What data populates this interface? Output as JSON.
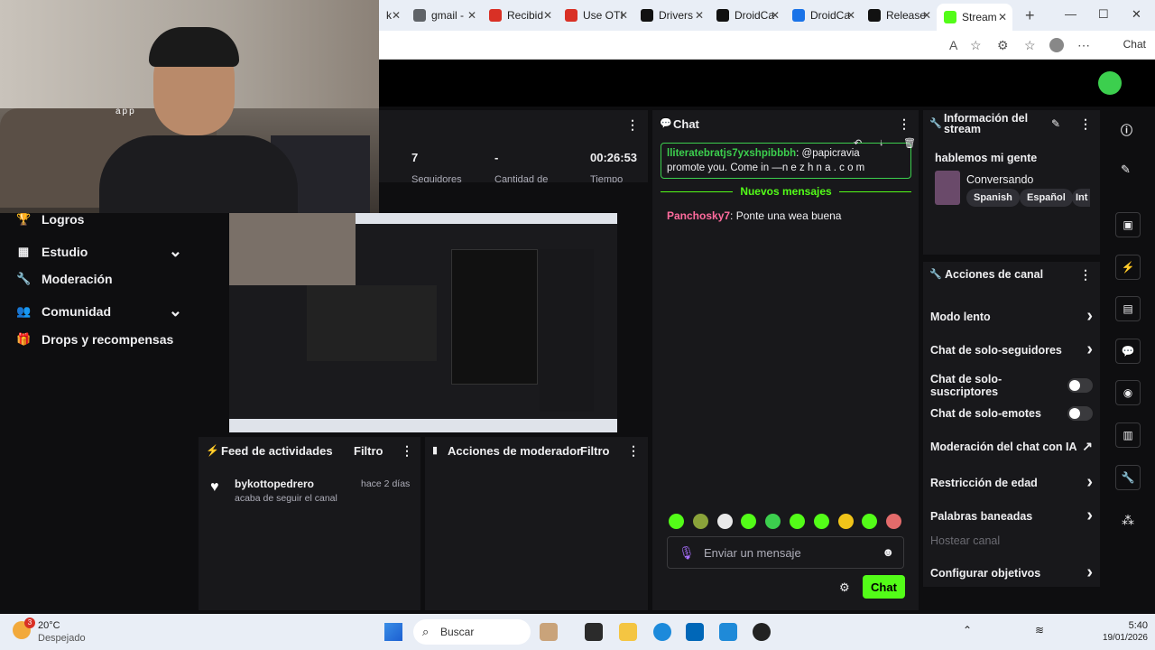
{
  "browser": {
    "tabs": [
      {
        "label": "k",
        "icon": "generic-tab-icon",
        "color": "#999999"
      },
      {
        "label": "gmail -",
        "icon": "search-icon",
        "color": "#5f6368"
      },
      {
        "label": "Recibid",
        "icon": "gmail-icon",
        "color": "#d93025"
      },
      {
        "label": "Use OTI",
        "icon": "gmail-icon",
        "color": "#d93025"
      },
      {
        "label": "Drivers",
        "icon": "app-icon",
        "color": "#111111"
      },
      {
        "label": "DroidCa",
        "icon": "github-icon",
        "color": "#111111"
      },
      {
        "label": "DroidCa",
        "icon": "app-store-icon",
        "color": "#1a73e8"
      },
      {
        "label": "Release",
        "icon": "github-icon",
        "color": "#111111"
      },
      {
        "label": "Stream",
        "icon": "kick-icon",
        "color": "#53fc18",
        "active": true
      }
    ],
    "chat_label": "Chat"
  },
  "webcam_overlay_text": "app",
  "left_menu": {
    "items": [
      {
        "label": "Logros",
        "icon": "trophy-icon",
        "expandable": false
      },
      {
        "label": "Estudio",
        "icon": "studio-icon",
        "expandable": true
      },
      {
        "label": "Moderación",
        "icon": "wrench-icon",
        "expandable": false
      },
      {
        "label": "Comunidad",
        "icon": "community-icon",
        "expandable": true
      },
      {
        "label": "Drops y recompensas",
        "icon": "gift-icon",
        "expandable": false
      }
    ]
  },
  "stats": {
    "followers": "7",
    "followers_label": "Seguidores",
    "quantity": "-",
    "quantity_label": "Cantidad de",
    "time": "00:26:53",
    "time_label": "Tiempo"
  },
  "activity_feed": {
    "title": "Feed de actividades",
    "filter": "Filtro",
    "items": [
      {
        "user": "bykottopedrero",
        "action": "acaba de seguir el canal",
        "time": "hace 2 días"
      }
    ]
  },
  "mod_actions": {
    "title": "Acciones de moderador",
    "filter": "Filtro"
  },
  "chat": {
    "title": "Chat",
    "pinned": {
      "user": "lliteratebratjs7yxshpibbbh",
      "text": ": @papicravia",
      "text_cont": "promote you. Come  in —n e z h n a . c o m"
    },
    "new_messages": "Nuevos mensajes",
    "messages": [
      {
        "user": "Panchosky7",
        "text": ": Ponte una wea buena"
      }
    ],
    "input_placeholder": "Enviar un mensaje",
    "send_label": "Chat"
  },
  "stream_info": {
    "title": "Información del stream",
    "stream_title": "hablemos mi gente",
    "category": "Conversando",
    "tags": [
      "Spanish",
      "Español",
      "Int"
    ]
  },
  "channel_actions": {
    "title": "Acciones de canal",
    "items": [
      {
        "label": "Modo lento",
        "control": "chevron"
      },
      {
        "label": "Chat de solo-seguidores",
        "control": "chevron"
      },
      {
        "label": "Chat de solo-suscriptores",
        "control": "toggle"
      },
      {
        "label": "Chat de solo-emotes",
        "control": "toggle"
      },
      {
        "label": "Moderación del chat con IA",
        "control": "external"
      },
      {
        "label": "Restricción de edad",
        "control": "chevron"
      },
      {
        "label": "Palabras baneadas",
        "control": "chevron"
      },
      {
        "label": "Hostear canal",
        "control": "none",
        "disabled": true
      },
      {
        "label": "Configurar objetivos",
        "control": "chevron"
      }
    ]
  },
  "taskbar": {
    "temperature": "20°C",
    "weather": "Despejado",
    "weather_badge": "3",
    "search": "Buscar",
    "time": "5:40",
    "date": "19/01/2026"
  },
  "colors": {
    "accent": "#53fc18",
    "background": "#0e0e10",
    "panel": "#18181b"
  }
}
